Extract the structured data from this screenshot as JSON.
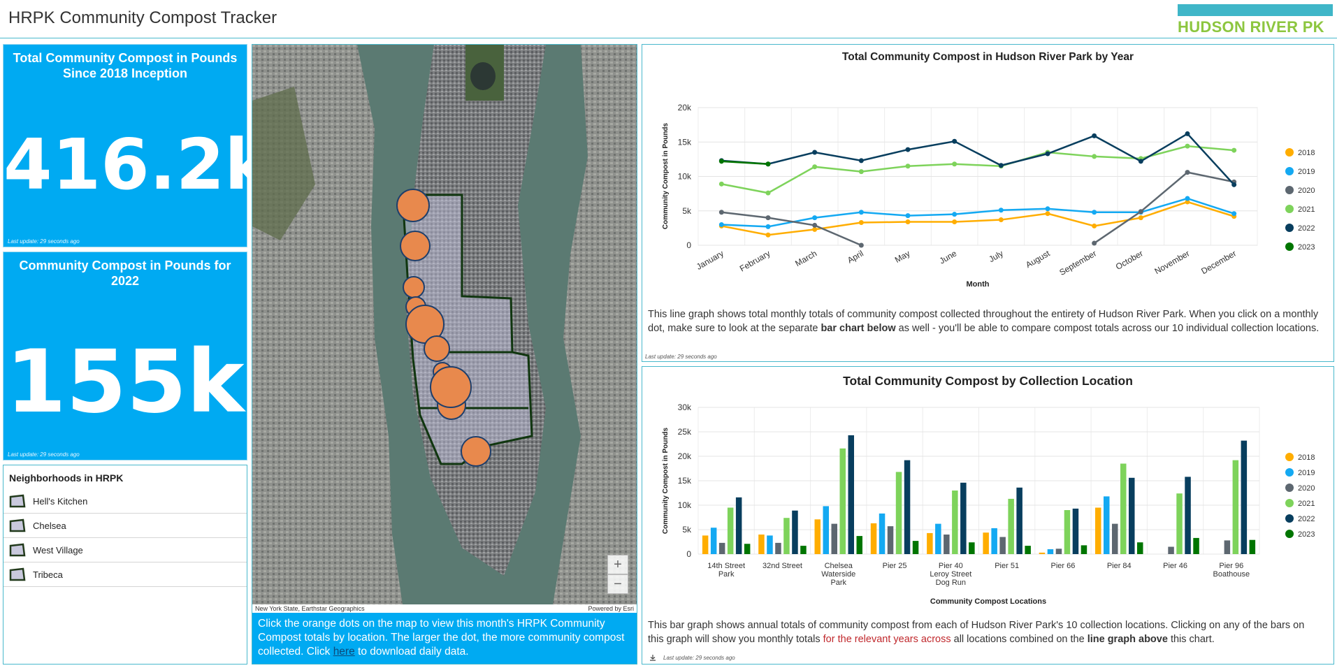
{
  "header": {
    "title": "HRPK Community Compost Tracker",
    "logo_text": "HUDSON RIVER PK"
  },
  "stats": [
    {
      "title": "Total Community Compost in Pounds Since 2018 Inception",
      "value": "416.2k",
      "update": "Last update: 29 seconds ago"
    },
    {
      "title": "Community Compost in Pounds for 2022",
      "value": "155k",
      "update": "Last update: 29 seconds ago"
    }
  ],
  "neighborhoods": {
    "title": "Neighborhoods in HRPK",
    "items": [
      "Hell's Kitchen",
      "Chelsea",
      "West Village",
      "Tribeca"
    ]
  },
  "map": {
    "attribution_left": "New York State, Earthstar Geographics",
    "attribution_right": "Powered by Esri",
    "zoom_in": "+",
    "zoom_out": "−",
    "caption_before": "Click the orange dots on the map to view this month's HRPK Community Compost totals by location. The larger the dot, the more community compost collected. Click ",
    "caption_link": "here",
    "caption_after": " to download daily data."
  },
  "colors": {
    "accent": "#00aaf2",
    "border": "#49b8cc",
    "s2018": "#ffad00",
    "s2019": "#14a9f2",
    "s2020": "#5d6770",
    "s2021": "#7ed35b",
    "s2022": "#083e5e",
    "s2023": "#007500",
    "marker": "#e8894d"
  },
  "line_panel": {
    "desc_1": "This line graph shows total monthly totals of community compost collected throughout the entirety of Hudson River Park. When you click on a monthly dot, make sure to look at the separate ",
    "desc_bold": "bar chart below",
    "desc_2": " as well - you'll be able to compare compost totals across our 10 individual collection locations.",
    "update": "Last update: 29 seconds ago"
  },
  "bar_panel": {
    "desc_1": "This bar graph shows annual totals of community compost from each of Hudson River Park's 10 collection locations. Clicking on any of the bars on this graph will show you monthly totals ",
    "desc_red": "for the relevant years across",
    "desc_2": " all locations combined on the ",
    "desc_bold": "line graph above",
    "desc_3": " this chart.",
    "update": "Last update: 29 seconds ago"
  },
  "chart_data": [
    {
      "type": "line",
      "title": "Total Community Compost in Hudson River Park by Year",
      "xlabel": "Month",
      "ylabel": "Community Compost in Pounds",
      "ylim": [
        0,
        20000
      ],
      "yticks": [
        "0",
        "5k",
        "10k",
        "15k",
        "20k"
      ],
      "categories": [
        "January",
        "February",
        "March",
        "April",
        "May",
        "June",
        "July",
        "August",
        "September",
        "October",
        "November",
        "December"
      ],
      "legend_position": "right",
      "series": [
        {
          "name": "2018",
          "values": [
            2800,
            1500,
            2300,
            3300,
            3400,
            3400,
            3700,
            4600,
            2800,
            4000,
            6300,
            4200
          ]
        },
        {
          "name": "2019",
          "values": [
            3000,
            2700,
            4000,
            4800,
            4300,
            4500,
            5100,
            5300,
            4800,
            4800,
            6800,
            4600
          ]
        },
        {
          "name": "2020",
          "values": [
            4800,
            4000,
            2900,
            0,
            null,
            null,
            null,
            null,
            300,
            4900,
            10600,
            9200
          ]
        },
        {
          "name": "2021",
          "values": [
            8900,
            7600,
            11400,
            10700,
            11500,
            11800,
            11500,
            13500,
            12900,
            12600,
            14400,
            13800
          ]
        },
        {
          "name": "2022",
          "values": [
            12300,
            11800,
            13500,
            12300,
            13900,
            15100,
            11600,
            13300,
            15900,
            12200,
            16200,
            8800
          ]
        },
        {
          "name": "2023",
          "values": [
            12200,
            11800,
            null,
            null,
            null,
            null,
            null,
            null,
            null,
            null,
            null,
            null
          ]
        }
      ]
    },
    {
      "type": "bar",
      "title": "Total Community Compost by Collection Location",
      "xlabel": "Community Compost Locations",
      "ylabel": "Community Compost in Pounds",
      "ylim": [
        0,
        30000
      ],
      "yticks": [
        "0",
        "5k",
        "10k",
        "15k",
        "20k",
        "25k",
        "30k"
      ],
      "categories": [
        [
          "14th Street",
          "Park"
        ],
        [
          "32nd Street"
        ],
        [
          "Chelsea",
          "Waterside",
          "Park"
        ],
        [
          "Pier 25"
        ],
        [
          "Pier 40",
          "Leroy Street",
          "Dog Run"
        ],
        [
          "Pier 51"
        ],
        [
          "Pier 66"
        ],
        [
          "Pier 84"
        ],
        [
          "Pier 46"
        ],
        [
          "Pier 96",
          "Boathouse"
        ]
      ],
      "legend_position": "right",
      "series": [
        {
          "name": "2018",
          "values": [
            3800,
            4000,
            7100,
            6300,
            4300,
            4400,
            300,
            9500,
            0,
            0
          ]
        },
        {
          "name": "2019",
          "values": [
            5400,
            3800,
            9800,
            8300,
            6200,
            5300,
            1000,
            11800,
            0,
            0
          ]
        },
        {
          "name": "2020",
          "values": [
            2300,
            2300,
            6200,
            5700,
            4000,
            3500,
            1100,
            6200,
            1500,
            2800
          ]
        },
        {
          "name": "2021",
          "values": [
            9500,
            7400,
            21600,
            16800,
            13000,
            11300,
            9000,
            18500,
            12400,
            19200
          ]
        },
        {
          "name": "2022",
          "values": [
            11600,
            8900,
            24300,
            19200,
            14600,
            13600,
            9300,
            15600,
            15800,
            23200
          ]
        },
        {
          "name": "2023",
          "values": [
            2100,
            1700,
            3700,
            2700,
            2400,
            1700,
            1800,
            2400,
            3300,
            2900
          ]
        }
      ]
    }
  ]
}
